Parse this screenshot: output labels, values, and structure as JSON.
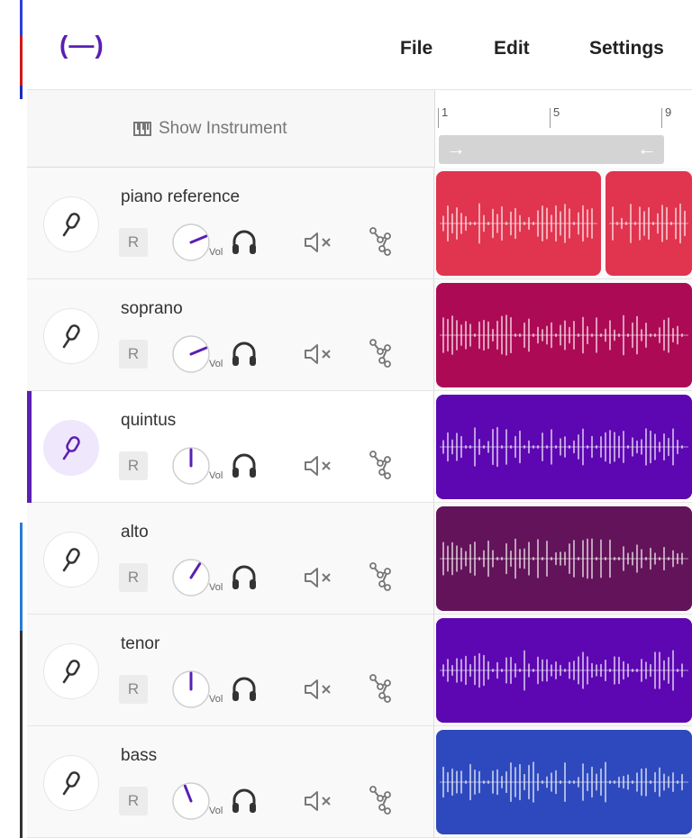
{
  "app": {
    "logo": "(—)",
    "menu": [
      {
        "label": "File"
      },
      {
        "label": "Edit"
      },
      {
        "label": "Settings"
      }
    ]
  },
  "header": {
    "show_instrument_label": "Show Instrument",
    "ruler_labels": [
      "1",
      "5",
      "9"
    ],
    "loop_start_arrow": "→",
    "loop_end_arrow": "←"
  },
  "colors": {
    "accent": "#5a1fb3",
    "piano_reference": "#e0344f",
    "soprano": "#ad0a55",
    "quintus": "#5c07b1",
    "alto": "#621359",
    "tenor": "#5c07b1",
    "bass": "#2e49bd"
  },
  "icons": {
    "mic": "microphone-icon",
    "record": "record-button",
    "volume": "volume-knob",
    "solo": "headphones-icon",
    "mute": "mute-icon",
    "effects": "effects-icon"
  },
  "tracks": [
    {
      "name": "piano reference",
      "record_label": "R",
      "vol_label": "Vol",
      "volume": 0.75,
      "color": "#e0344f",
      "selected": false
    },
    {
      "name": "soprano",
      "record_label": "R",
      "vol_label": "Vol",
      "volume": 0.75,
      "color": "#ad0a55",
      "selected": false
    },
    {
      "name": "quintus",
      "record_label": "R",
      "vol_label": "Vol",
      "volume": 0.5,
      "color": "#5c07b1",
      "selected": true
    },
    {
      "name": "alto",
      "record_label": "R",
      "vol_label": "Vol",
      "volume": 0.62,
      "color": "#621359",
      "selected": false
    },
    {
      "name": "tenor",
      "record_label": "R",
      "vol_label": "Vol",
      "volume": 0.5,
      "color": "#5c07b1",
      "selected": false
    },
    {
      "name": "bass",
      "record_label": "R",
      "vol_label": "Vol",
      "volume": 0.42,
      "color": "#2e49bd",
      "selected": false
    }
  ]
}
